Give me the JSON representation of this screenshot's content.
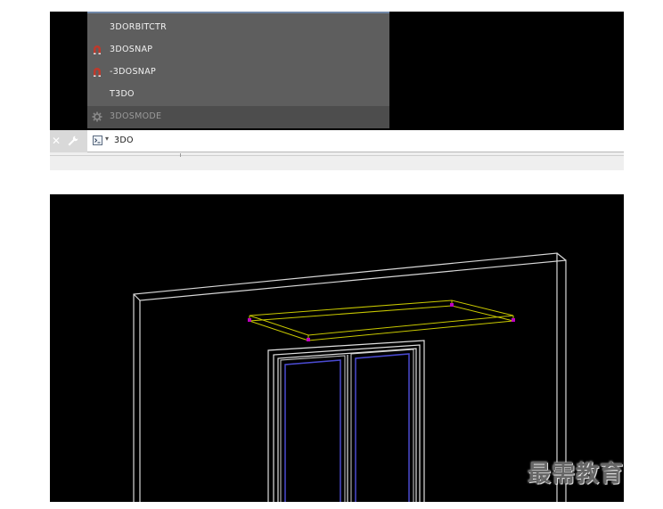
{
  "autocomplete": {
    "items": [
      {
        "label": "3DORBITCTR",
        "icon": "none",
        "disabled": false
      },
      {
        "label": "3DOSNAP",
        "icon": "magnet-icon",
        "disabled": false
      },
      {
        "label": "-3DOSNAP",
        "icon": "magnet-icon",
        "disabled": false
      },
      {
        "label": "T3DO",
        "icon": "none",
        "disabled": false
      },
      {
        "label": "3DOSMODE",
        "icon": "gear-icon",
        "disabled": true
      }
    ]
  },
  "command_line": {
    "input_value": "3DO",
    "close_icon": "close-icon",
    "settings_icon": "wrench-icon",
    "prompt_icon": "command-prompt-icon"
  },
  "watermark": {
    "text": "最需教育"
  },
  "colors": {
    "viewport_bg": "#000000",
    "wall_lines": "#d8d8d8",
    "canopy_lines": "#c8c800",
    "glass_lines": "#4a4ad0",
    "grip_points": "#c000c0"
  }
}
